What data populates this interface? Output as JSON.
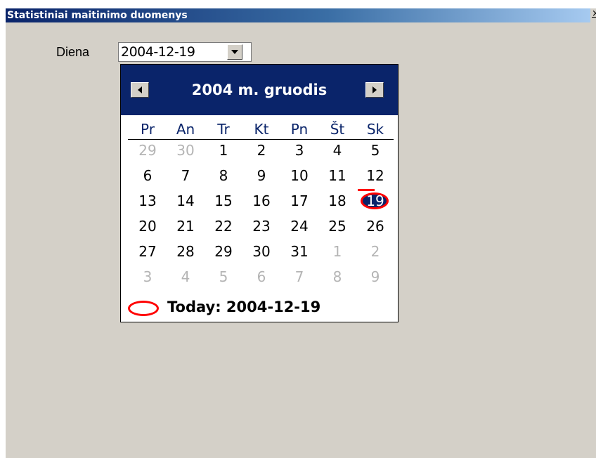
{
  "window": {
    "title": "Statistiniai maitinimo duomenys",
    "close_glyph": "×"
  },
  "form": {
    "label": "Diena",
    "date_value": "2004-12-19"
  },
  "calendar": {
    "month_title": "2004 m. gruodis",
    "weekdays": [
      "Pr",
      "An",
      "Tr",
      "Kt",
      "Pn",
      "Št",
      "Sk"
    ],
    "weeks": [
      [
        "29",
        "30",
        "1",
        "2",
        "3",
        "4",
        "5"
      ],
      [
        "6",
        "7",
        "8",
        "9",
        "10",
        "11",
        "12"
      ],
      [
        "13",
        "14",
        "15",
        "16",
        "17",
        "18",
        "19"
      ],
      [
        "20",
        "21",
        "22",
        "23",
        "24",
        "25",
        "26"
      ],
      [
        "27",
        "28",
        "29",
        "30",
        "31",
        "1",
        "2"
      ],
      [
        "3",
        "4",
        "5",
        "6",
        "7",
        "8",
        "9"
      ]
    ],
    "other_month_mask": [
      [
        true,
        true,
        false,
        false,
        false,
        false,
        false
      ],
      [
        false,
        false,
        false,
        false,
        false,
        false,
        false
      ],
      [
        false,
        false,
        false,
        false,
        false,
        false,
        false
      ],
      [
        false,
        false,
        false,
        false,
        false,
        false,
        false
      ],
      [
        false,
        false,
        false,
        false,
        false,
        true,
        true
      ],
      [
        true,
        true,
        true,
        true,
        true,
        true,
        true
      ]
    ],
    "selected_day": "19",
    "today_text": "Today: 2004-12-19"
  },
  "colors": {
    "titlebar_start": "#0a246a",
    "titlebar_end": "#a6caf0",
    "calendar_header": "#0a246a",
    "selection": "#0a246a",
    "highlight_ring": "#ff0000",
    "other_month_text": "#b4b4b4",
    "window_bg": "#d4d0c8"
  },
  "icons": {
    "close": "close-icon",
    "dropdown": "chevron-down-icon",
    "prev": "chevron-left-icon",
    "next": "chevron-right-icon"
  }
}
